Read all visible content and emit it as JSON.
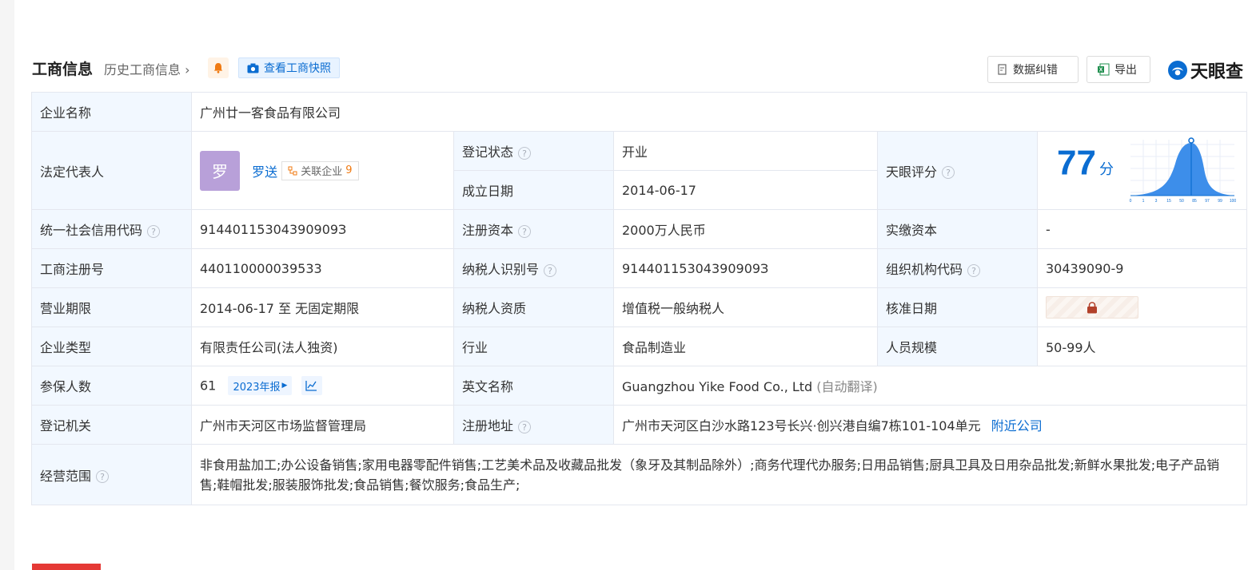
{
  "header": {
    "title": "工商信息",
    "history_link": "历史工商信息",
    "snapshot_button": "查看工商快照",
    "correct_button": "数据纠错",
    "export_button": "导出",
    "logo_text": "天眼查"
  },
  "rows": {
    "company_name": {
      "label": "企业名称",
      "value": "广州廿一客食品有限公司"
    },
    "legal_rep": {
      "label": "法定代表人",
      "avatar_char": "罗",
      "name": "罗送",
      "related_label": "关联企业",
      "related_count": "9"
    },
    "reg_status": {
      "label": "登记状态",
      "value": "开业"
    },
    "established": {
      "label": "成立日期",
      "value": "2014-06-17"
    },
    "score": {
      "label": "天眼评分",
      "value": "77",
      "unit": "分",
      "chart_ticks": [
        "0",
        "1",
        "3",
        "15",
        "50",
        "85",
        "97",
        "99",
        "100"
      ]
    },
    "credit_code": {
      "label": "统一社会信用代码",
      "value": "91440115304390909З"
    },
    "reg_capital": {
      "label": "注册资本",
      "value": "2000万人民币"
    },
    "paid_capital": {
      "label": "实缴资本",
      "value": "-"
    },
    "reg_number": {
      "label": "工商注册号",
      "value": "440110000039533"
    },
    "taxpayer_id": {
      "label": "纳税人识别号",
      "value": "91440115304390909З"
    },
    "org_code": {
      "label": "组织机构代码",
      "value": "30439090-9"
    },
    "term": {
      "label": "营业期限",
      "value": "2014-06-17 至 无固定期限"
    },
    "taxpayer_type": {
      "label": "纳税人资质",
      "value": "增值税一般纳税人"
    },
    "approval_date": {
      "label": "核准日期"
    },
    "company_type": {
      "label": "企业类型",
      "value": "有限责任公司(法人独资)"
    },
    "industry": {
      "label": "行业",
      "value": "食品制造业"
    },
    "staff_size": {
      "label": "人员规模",
      "value": "50-99人"
    },
    "insured": {
      "label": "参保人数",
      "value": "61",
      "year_tag": "2023年报"
    },
    "english_name": {
      "label": "英文名称",
      "value": "Guangzhou Yike Food Co., Ltd",
      "note": "(自动翻译)"
    },
    "authority": {
      "label": "登记机关",
      "value": "广州市天河区市场监督管理局"
    },
    "address": {
      "label": "注册地址",
      "value": "广州市天河区白沙水路123号长兴·创兴港自编7栋101-104单元",
      "link": "附近公司"
    },
    "scope": {
      "label": "经营范围",
      "value": "非食用盐加工;办公设备销售;家用电器零配件销售;工艺美术品及收藏品批发（象牙及其制品除外）;商务代理代办服务;日用品销售;厨具卫具及日用杂品批发;新鲜水果批发;电子产品销售;鞋帽批发;服装服饰批发;食品销售;餐饮服务;食品生产;"
    }
  }
}
